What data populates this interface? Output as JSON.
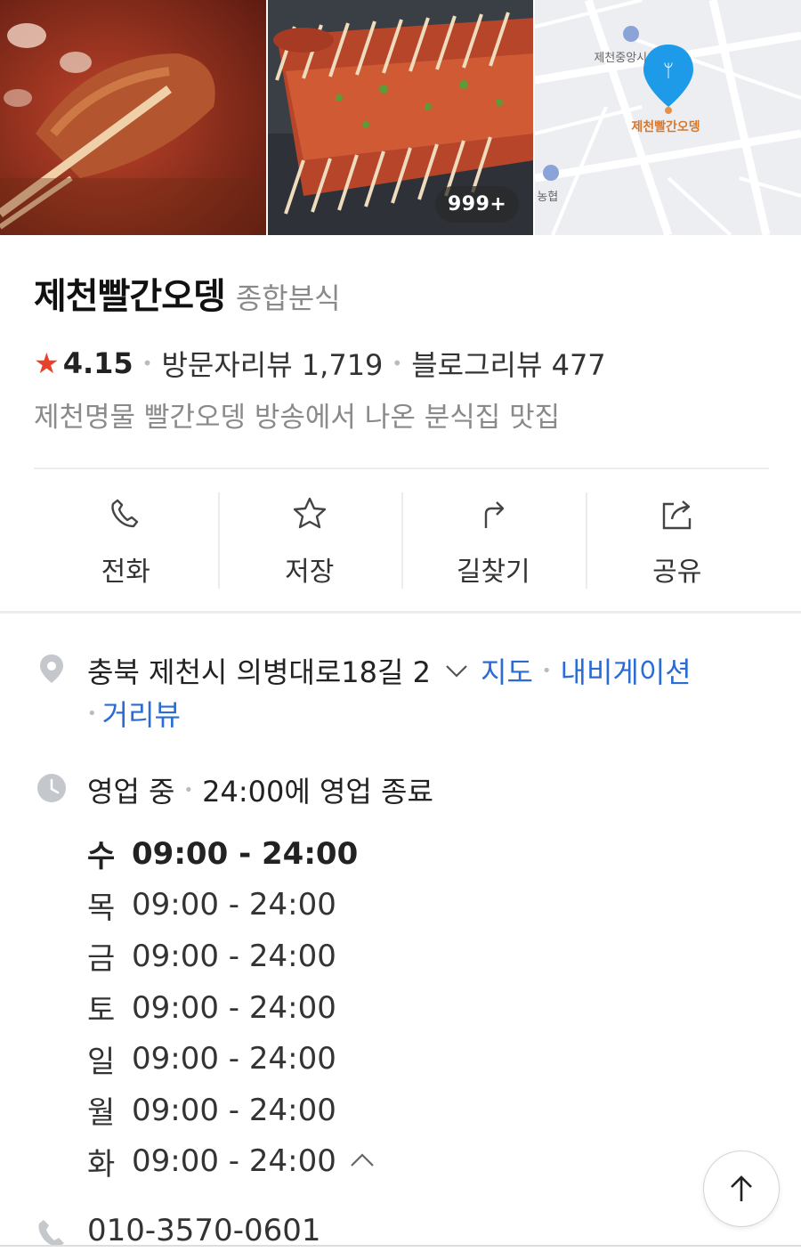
{
  "photos": {
    "count_badge": "999+",
    "map_labels": {
      "landmark": "제천중앙시",
      "place": "제천빨간오뎅",
      "bank": "농협"
    }
  },
  "place": {
    "name": "제천빨간오뎅",
    "category": "종합분식",
    "rating": "4.15",
    "visitor_reviews": "방문자리뷰 1,719",
    "blog_reviews": "블로그리뷰 477",
    "description": "제천명물 빨간오뎅 방송에서 나온 분식집 맛집"
  },
  "actions": [
    {
      "label": "전화",
      "icon": "phone-icon"
    },
    {
      "label": "저장",
      "icon": "star-outline-icon"
    },
    {
      "label": "길찾기",
      "icon": "directions-icon"
    },
    {
      "label": "공유",
      "icon": "share-icon"
    }
  ],
  "address": {
    "text": "충북 제천시 의병대로18길 2",
    "link_map": "지도",
    "link_navi": "내비게이션",
    "link_street": "거리뷰"
  },
  "hours": {
    "status": "영업 중",
    "closing": "24:00에 영업 종료",
    "days": [
      {
        "day": "수",
        "time": "09:00 - 24:00",
        "today": true
      },
      {
        "day": "목",
        "time": "09:00 - 24:00"
      },
      {
        "day": "금",
        "time": "09:00 - 24:00"
      },
      {
        "day": "토",
        "time": "09:00 - 24:00"
      },
      {
        "day": "일",
        "time": "09:00 - 24:00"
      },
      {
        "day": "월",
        "time": "09:00 - 24:00"
      },
      {
        "day": "화",
        "time": "09:00 - 24:00"
      }
    ]
  },
  "phone": "010-3570-0601",
  "colors": {
    "accent_link": "#2b6cd4",
    "star": "#e8412c",
    "map_pin": "#1e9be8"
  }
}
